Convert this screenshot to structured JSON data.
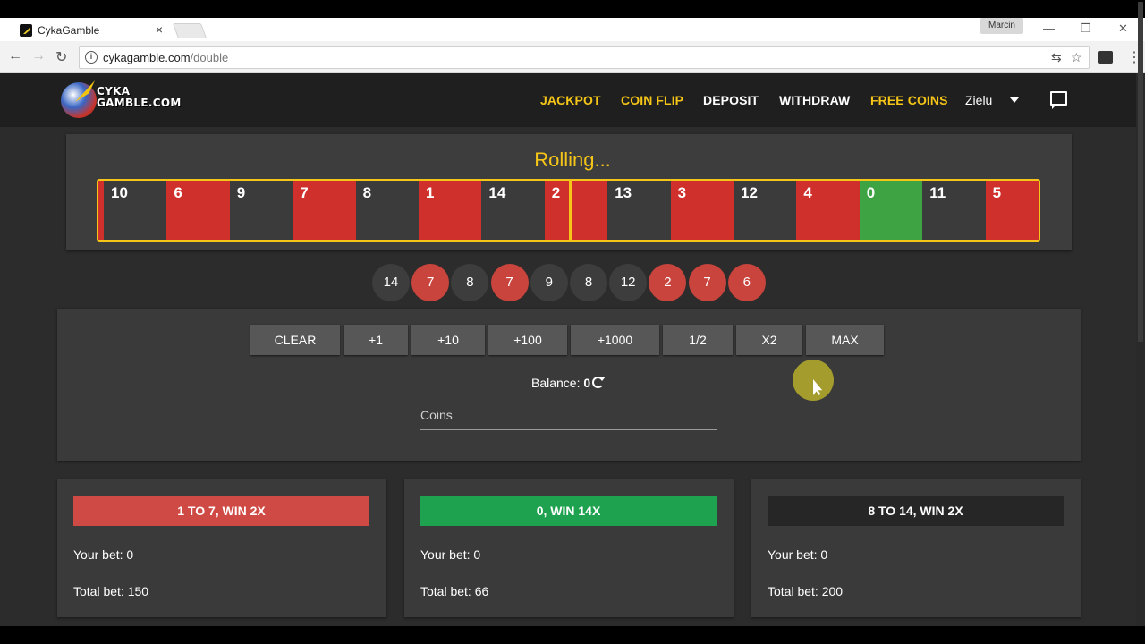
{
  "browser": {
    "tab_title": "CykaGamble",
    "tab_close": "×",
    "profile_name": "Marcin",
    "url_host": "cykagamble.com",
    "url_path": "/double",
    "back_icon": "←",
    "forward_icon": "→",
    "reload_icon": "↻",
    "star_icon": "☆",
    "translate_icon": "⇆",
    "menu_icon": "⋮",
    "minimize": "—",
    "restore": "❐",
    "close": "✕"
  },
  "header": {
    "logo_line1": "CYKA",
    "logo_line2": "GAMBLE.COM",
    "nav": {
      "jackpot": "JACKPOT",
      "coin_flip": "COIN FLIP",
      "deposit": "DEPOSIT",
      "withdraw": "WITHDRAW",
      "free_coins": "FREE COINS"
    },
    "user": "Zielu"
  },
  "roll": {
    "status": "Rolling...",
    "tiles": [
      {
        "n": "10",
        "color": "black"
      },
      {
        "n": "6",
        "color": "red"
      },
      {
        "n": "9",
        "color": "black"
      },
      {
        "n": "7",
        "color": "red"
      },
      {
        "n": "8",
        "color": "black"
      },
      {
        "n": "1",
        "color": "red"
      },
      {
        "n": "14",
        "color": "black"
      },
      {
        "n": "2",
        "color": "red"
      },
      {
        "n": "13",
        "color": "black"
      },
      {
        "n": "3",
        "color": "red"
      },
      {
        "n": "12",
        "color": "black"
      },
      {
        "n": "4",
        "color": "red"
      },
      {
        "n": "0",
        "color": "green"
      },
      {
        "n": "11",
        "color": "black"
      },
      {
        "n": "5",
        "color": "red"
      }
    ]
  },
  "history": [
    {
      "n": "14",
      "color": "black"
    },
    {
      "n": "7",
      "color": "red"
    },
    {
      "n": "8",
      "color": "black"
    },
    {
      "n": "7",
      "color": "red"
    },
    {
      "n": "9",
      "color": "black"
    },
    {
      "n": "8",
      "color": "black"
    },
    {
      "n": "12",
      "color": "black"
    },
    {
      "n": "2",
      "color": "red"
    },
    {
      "n": "7",
      "color": "red"
    },
    {
      "n": "6",
      "color": "red"
    }
  ],
  "bet_controls": {
    "clear": "CLEAR",
    "plus1": "+1",
    "plus10": "+10",
    "plus100": "+100",
    "plus1000": "+1000",
    "half": "1/2",
    "double": "X2",
    "max": "MAX",
    "balance_label": "Balance:",
    "balance_value": "0",
    "coins_placeholder": "Coins"
  },
  "bets": {
    "red": {
      "label": "1 TO 7, WIN 2X",
      "your_bet": "Your bet: 0",
      "total_bet": "Total bet: 150"
    },
    "green": {
      "label": "0, WIN 14X",
      "your_bet": "Your bet: 0",
      "total_bet": "Total bet: 66"
    },
    "black": {
      "label": "8 TO 14, WIN 2X",
      "your_bet": "Your bet: 0",
      "total_bet": "Total bet: 200"
    }
  },
  "colors": {
    "gold": "#f5c518",
    "red": "#d0302c",
    "green": "#3ea343",
    "black": "#3b3b3b"
  }
}
